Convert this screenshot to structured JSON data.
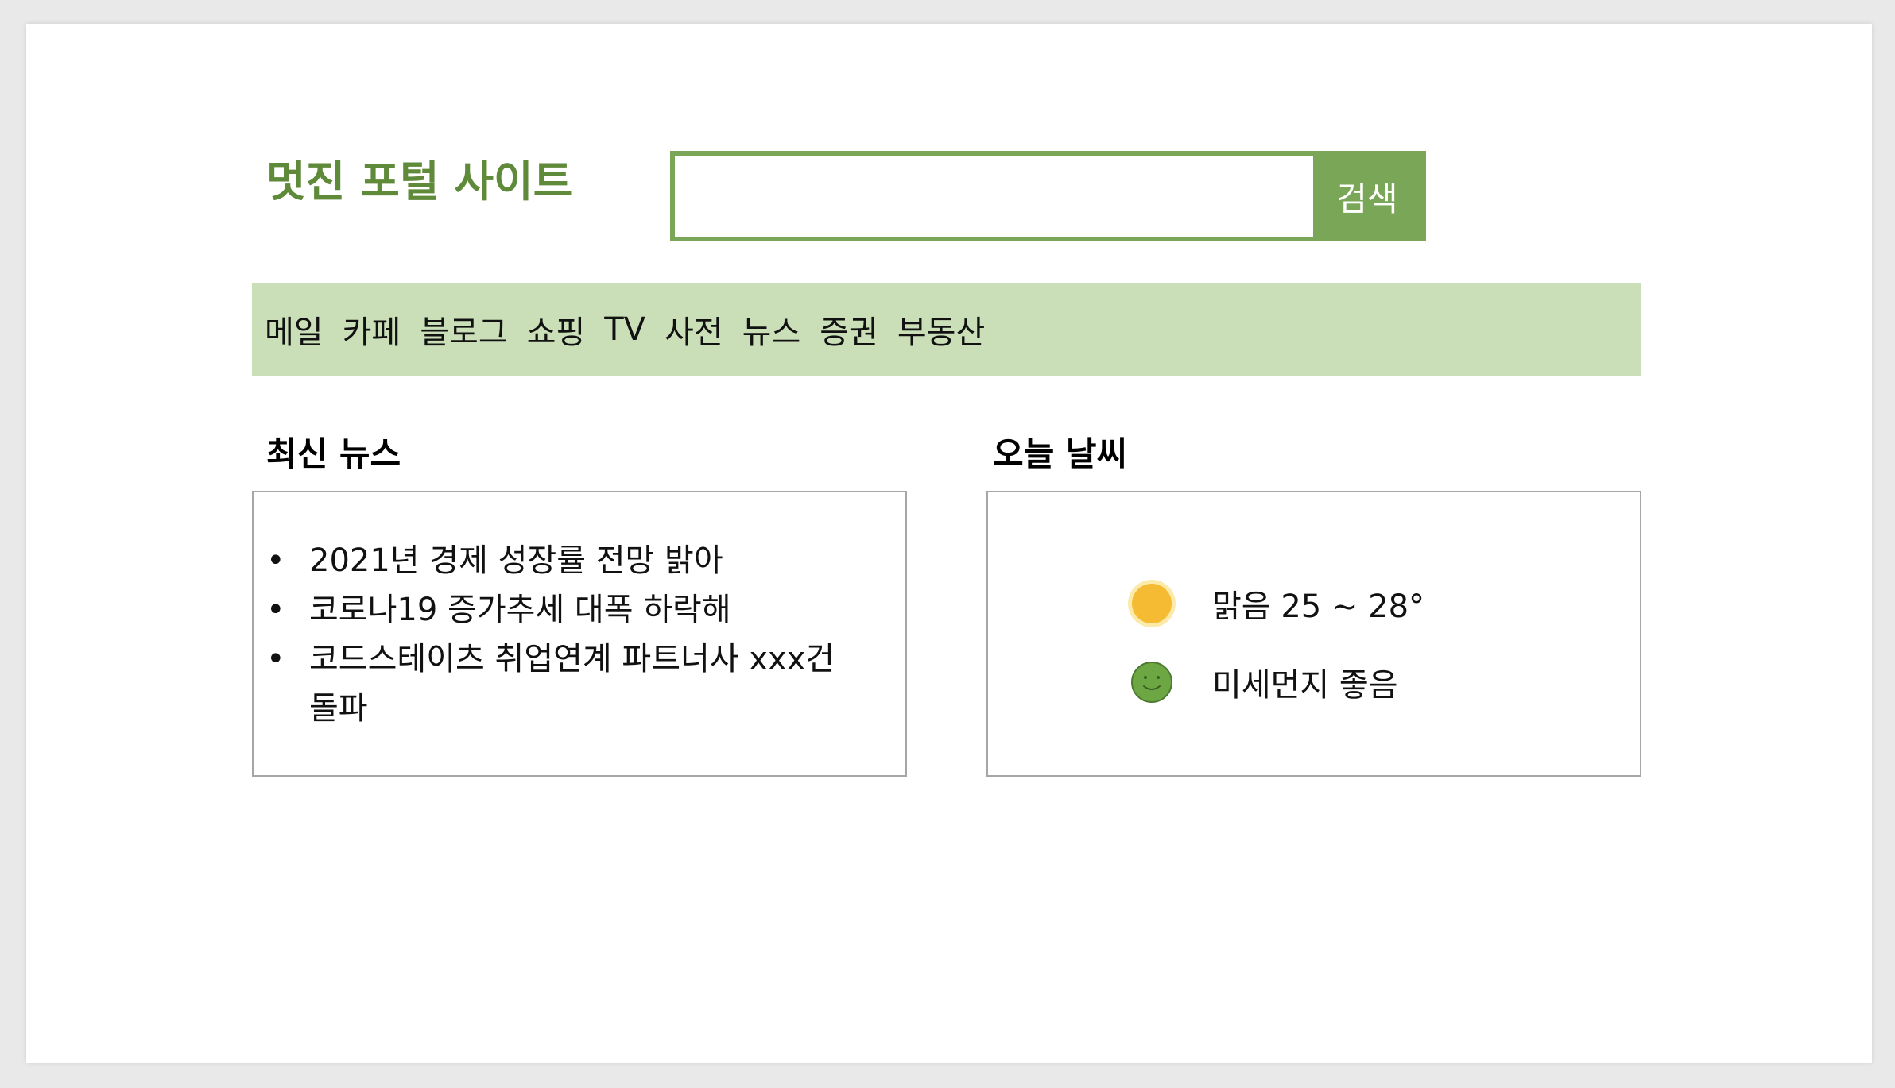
{
  "header": {
    "site_title": "멋진 포털 사이트",
    "search_value": "",
    "search_button": "검색"
  },
  "nav": {
    "items": [
      "메일",
      "카페",
      "블로그",
      "쇼핑",
      "TV",
      "사전",
      "뉴스",
      "증권",
      "부동산"
    ]
  },
  "news": {
    "title": "최신 뉴스",
    "items": [
      "2021년 경제 성장률 전망 밝아",
      "코로나19 증가추세 대폭 하락해",
      "코드스테이츠 취업연계 파트너사 xxx건 돌파"
    ]
  },
  "weather": {
    "title": "오늘 날씨",
    "condition_text": "맑음 25 ~ 28°",
    "condition_icon": "sun-icon",
    "dust_text": "미세먼지 좋음",
    "dust_icon": "smiley-face-icon"
  },
  "colors": {
    "brand": "#5f8a3a",
    "accent": "#7aa757",
    "nav_bg": "#cadfb8",
    "sun": "#f5bc33",
    "smiley": "#6ca744"
  }
}
